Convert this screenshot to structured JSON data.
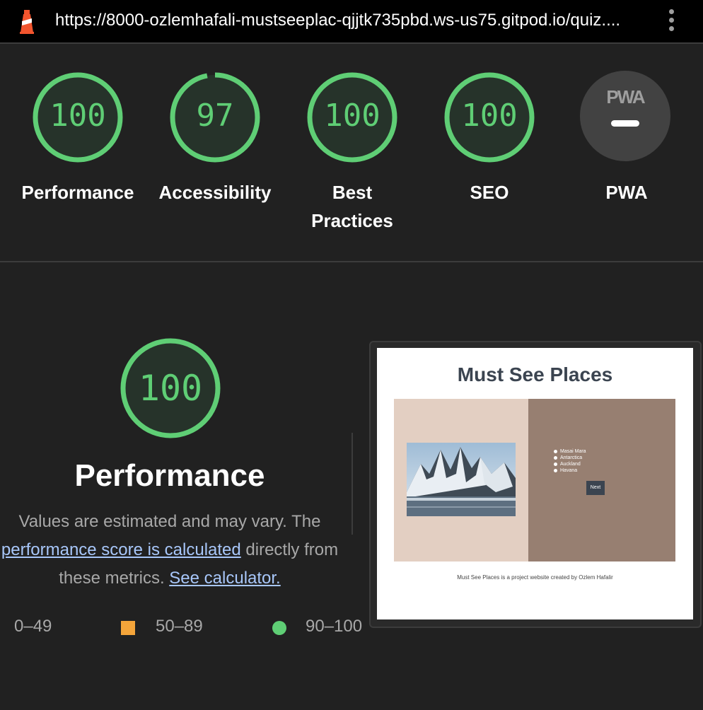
{
  "browser": {
    "url": "https://8000-ozlemhafali-mustseeplac-qjjtk735pbd.ws-us75.gitpod.io/quiz...."
  },
  "categories": [
    {
      "id": "performance",
      "score": "100",
      "label": "Performance"
    },
    {
      "id": "accessibility",
      "score": "97",
      "label": "Accessibility"
    },
    {
      "id": "best-practices",
      "score": "100",
      "label": "Best Practices"
    },
    {
      "id": "seo",
      "score": "100",
      "label": "SEO"
    },
    {
      "id": "pwa",
      "score": "",
      "badge": "PWA",
      "label": "PWA"
    }
  ],
  "detail": {
    "score": "100",
    "title": "Performance",
    "desc_prefix": "Values are estimated and may vary. The ",
    "desc_link1": "performance score is calculated",
    "desc_middle": " directly from these metrics. ",
    "desc_link2": "See calculator."
  },
  "legend": [
    {
      "range": "0–49",
      "color": "#ff4e42"
    },
    {
      "range": "50–89",
      "color": "#f4a53a"
    },
    {
      "range": "90–100",
      "color": "#5fce75"
    }
  ],
  "screenshot": {
    "title": "Must See Places",
    "places": [
      "Masai Mara",
      "Antarctica",
      "Auckland",
      "Havana"
    ],
    "next_label": "Next",
    "footer": "Must See Places is a project website created by Ozlem Hafalir"
  },
  "colors": {
    "pass": "#5fce75",
    "average": "#f4a53a",
    "background": "#212121",
    "link": "#a8c7fa"
  }
}
